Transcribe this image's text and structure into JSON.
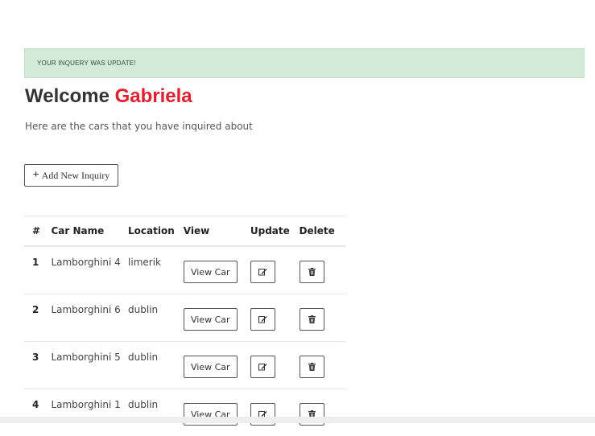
{
  "alert": {
    "text": "YOUR INQUERY WAS UPDATE!"
  },
  "header": {
    "welcome": "Welcome",
    "name": "Gabriela"
  },
  "subtitle": "Here are the cars that you have inquired about",
  "add_button": {
    "label": "Add New Inquiry",
    "icon": "plus-icon"
  },
  "table": {
    "headers": [
      "#",
      "Car Name",
      "Location",
      "View",
      "Update",
      "Delete"
    ],
    "rows": [
      {
        "num": "1",
        "car": "Lamborghini 4",
        "location": "limerik",
        "view_label": "View Car"
      },
      {
        "num": "2",
        "car": "Lamborghini 6",
        "location": "dublin",
        "view_label": "View Car"
      },
      {
        "num": "3",
        "car": "Lamborghini 5",
        "location": "dublin",
        "view_label": "View Car"
      },
      {
        "num": "4",
        "car": "Lamborghini 1",
        "location": "dublin",
        "view_label": "View Car"
      }
    ],
    "update_icon": "edit-icon",
    "delete_icon": "trash-icon"
  },
  "colors": {
    "alert_bg": "#d4ead9",
    "name_accent": "#e0202e"
  }
}
